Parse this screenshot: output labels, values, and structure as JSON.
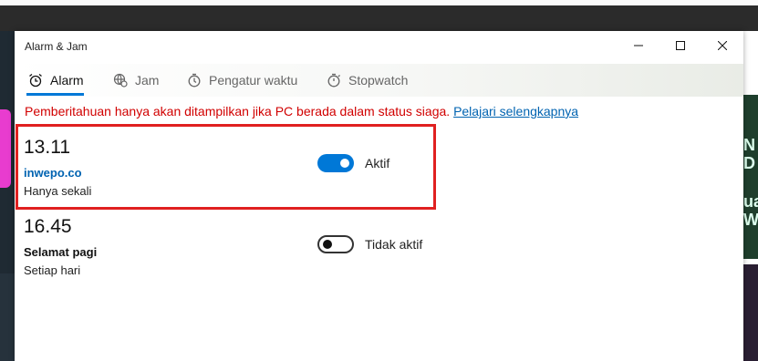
{
  "window": {
    "title": "Alarm & Jam"
  },
  "tabs": [
    {
      "label": "Alarm",
      "icon": "alarm-clock-icon",
      "active": true
    },
    {
      "label": "Jam",
      "icon": "world-clock-icon",
      "active": false
    },
    {
      "label": "Pengatur waktu",
      "icon": "timer-icon",
      "active": false
    },
    {
      "label": "Stopwatch",
      "icon": "stopwatch-icon",
      "active": false
    }
  ],
  "notice": {
    "text": "Pemberitahuan hanya akan ditampilkan jika PC berada dalam status siaga.",
    "link": "Pelajari selengkapnya"
  },
  "alarms": [
    {
      "time": "13.11",
      "name": "inwepo.co",
      "repeat": "Hanya sekali",
      "enabled": true,
      "status_label": "Aktif"
    },
    {
      "time": "16.45",
      "name": "Selamat pagi",
      "repeat": "Setiap hari",
      "enabled": false,
      "status_label": "Tidak aktif"
    }
  ],
  "background_glyphs": [
    "N",
    "D",
    "ua",
    "Wh"
  ],
  "colors": {
    "accent": "#0078d7",
    "link": "#0063b1",
    "notice_text": "#d10000",
    "highlight_border": "#e02020"
  }
}
